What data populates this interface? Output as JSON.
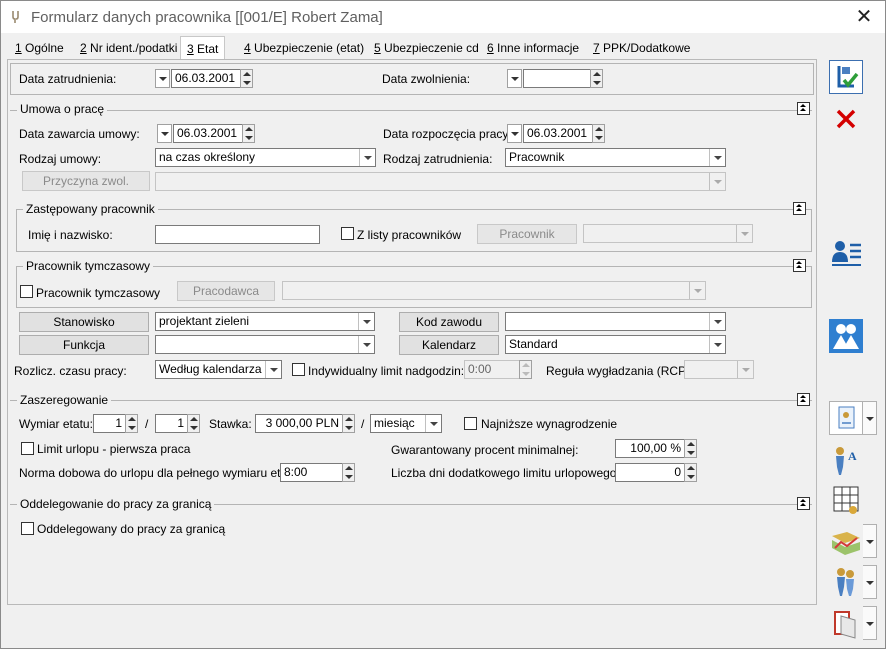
{
  "window": {
    "title": "Formularz danych pracownika [[001/E] Robert Zama]",
    "close_glyph": "✕"
  },
  "tabs": [
    {
      "key": "1",
      "label": " Ogólne"
    },
    {
      "key": "2",
      "label": " Nr ident./podatki"
    },
    {
      "key": "3",
      "label": " Etat"
    },
    {
      "key": "4",
      "label": " Ubezpieczenie (etat)"
    },
    {
      "key": "5",
      "label": " Ubezpieczenie cd"
    },
    {
      "key": "6",
      "label": " Inne informacje"
    },
    {
      "key": "7",
      "label": " PPK/Dodatkowe"
    }
  ],
  "top": {
    "hire_date_label": "Data zatrudnienia:",
    "hire_date": "06.03.2001",
    "dismissal_label": "Data zwolnienia:",
    "dismissal_date": ""
  },
  "contract": {
    "section_title": "Umowa o pracę",
    "concluded_label": "Data zawarcia umowy:",
    "concluded_date": "06.03.2001",
    "start_label": "Data rozpoczęcia pracy:",
    "start_date": "06.03.2001",
    "type_label": "Rodzaj umowy:",
    "type_value": "na czas określony",
    "employment_label": "Rodzaj zatrudnienia:",
    "employment_value": "Pracownik",
    "reason_button": "Przyczyna zwol.",
    "reason_value": ""
  },
  "replaced": {
    "section_title": "Zastępowany pracownik",
    "name_label": "Imię i nazwisko:",
    "name_value": "",
    "from_list_label": "Z listy pracowników",
    "employee_button": "Pracownik",
    "employee_value": ""
  },
  "temporary": {
    "section_title": "Pracownik tymczasowy",
    "checkbox_label": "Pracownik tymczasowy",
    "employer_button": "Pracodawca",
    "employer_value": ""
  },
  "position": {
    "position_button": "Stanowisko",
    "position_value": "projektant zieleni",
    "occupation_code_button": "Kod zawodu",
    "occupation_code_value": "",
    "function_button": "Funkcja",
    "function_value": "",
    "calendar_button": "Kalendarz",
    "calendar_value": "Standard",
    "worktime_label": "Rozlicz. czasu pracy:",
    "worktime_value": "Według kalendarza",
    "individual_limit_label": "Indywidualny limit nadgodzin:",
    "individual_limit_value": "0:00",
    "smoothing_label": "Reguła wygładzania (RCP):",
    "smoothing_value": ""
  },
  "grading": {
    "section_title": "Zaszeregowanie",
    "fte_label": "Wymiar etatu:",
    "fte_num": "1",
    "fte_sep": "/",
    "fte_den": "1",
    "rate_label": "Stawka:",
    "rate_value": "3 000,00 PLN",
    "rate_sep": "/",
    "period_value": "miesiąc",
    "min_wage_label": "Najniższe wynagrodzenie",
    "leave_limit_label": "Limit urlopu - pierwsza praca",
    "guaranteed_label": "Gwarantowany procent minimalnej:",
    "guaranteed_value": "100,00 %",
    "daily_norm_label": "Norma dobowa do urlopu dla pełnego wymiaru etatu:",
    "daily_norm_value": "8:00",
    "extra_days_label": "Liczba dni dodatkowego limitu urlopowego:",
    "extra_days_value": "0"
  },
  "abroad": {
    "section_title": "Oddelegowanie do pracy za granicą",
    "checkbox_label": "Oddelegowany do pracy za granicą"
  },
  "colors": {
    "accent": "#1f5fa8",
    "cancel": "#d40000",
    "border": "#b4b4b4"
  }
}
